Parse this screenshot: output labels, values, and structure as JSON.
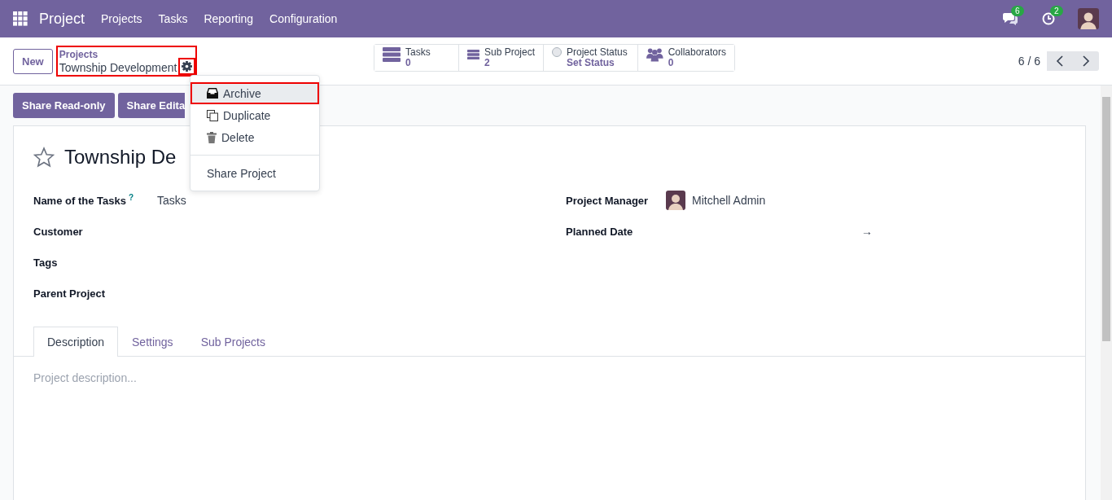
{
  "topbar": {
    "app": "Project",
    "menu": [
      "Projects",
      "Tasks",
      "Reporting",
      "Configuration"
    ],
    "messages_badge": "6",
    "activities_badge": "2"
  },
  "control_panel": {
    "new_button": "New",
    "breadcrumb": "Projects",
    "record": "Township Development",
    "smart_buttons": [
      {
        "kind": "list",
        "label": "Tasks",
        "value": "0"
      },
      {
        "kind": "list",
        "label": "Sub Project",
        "value": "2"
      },
      {
        "kind": "status",
        "label": "Project Status",
        "value": "Set Status"
      },
      {
        "kind": "people",
        "label": "Collaborators",
        "value": "0"
      }
    ],
    "pager": "6 / 6"
  },
  "action_buttons": [
    "Share Read-only",
    "Share Edita"
  ],
  "gear_menu": {
    "items": [
      {
        "kind": "archive",
        "label": "Archive",
        "selected": true
      },
      {
        "kind": "duplicate",
        "label": "Duplicate",
        "selected": false
      },
      {
        "kind": "delete",
        "label": "Delete",
        "selected": false
      },
      {
        "kind": "plain",
        "label": "Share Project",
        "selected": false
      }
    ]
  },
  "form": {
    "title": "Township De",
    "favorite": false,
    "left_fields": [
      {
        "label": "Name of the Tasks",
        "help": "?",
        "value": "Tasks"
      },
      {
        "label": "Customer"
      },
      {
        "label": "Tags"
      },
      {
        "label": "Parent Project"
      }
    ],
    "right_fields": [
      {
        "label": "Project Manager",
        "value": "Mitchell Admin",
        "kind": "user"
      },
      {
        "label": "Planned Date",
        "value": "→",
        "kind": "daterange"
      }
    ],
    "tabs": [
      {
        "label": "Description",
        "selected": true
      },
      {
        "label": "Settings",
        "selected": false
      },
      {
        "label": "Sub Projects",
        "selected": false
      }
    ],
    "description_placeholder": "Project description..."
  }
}
